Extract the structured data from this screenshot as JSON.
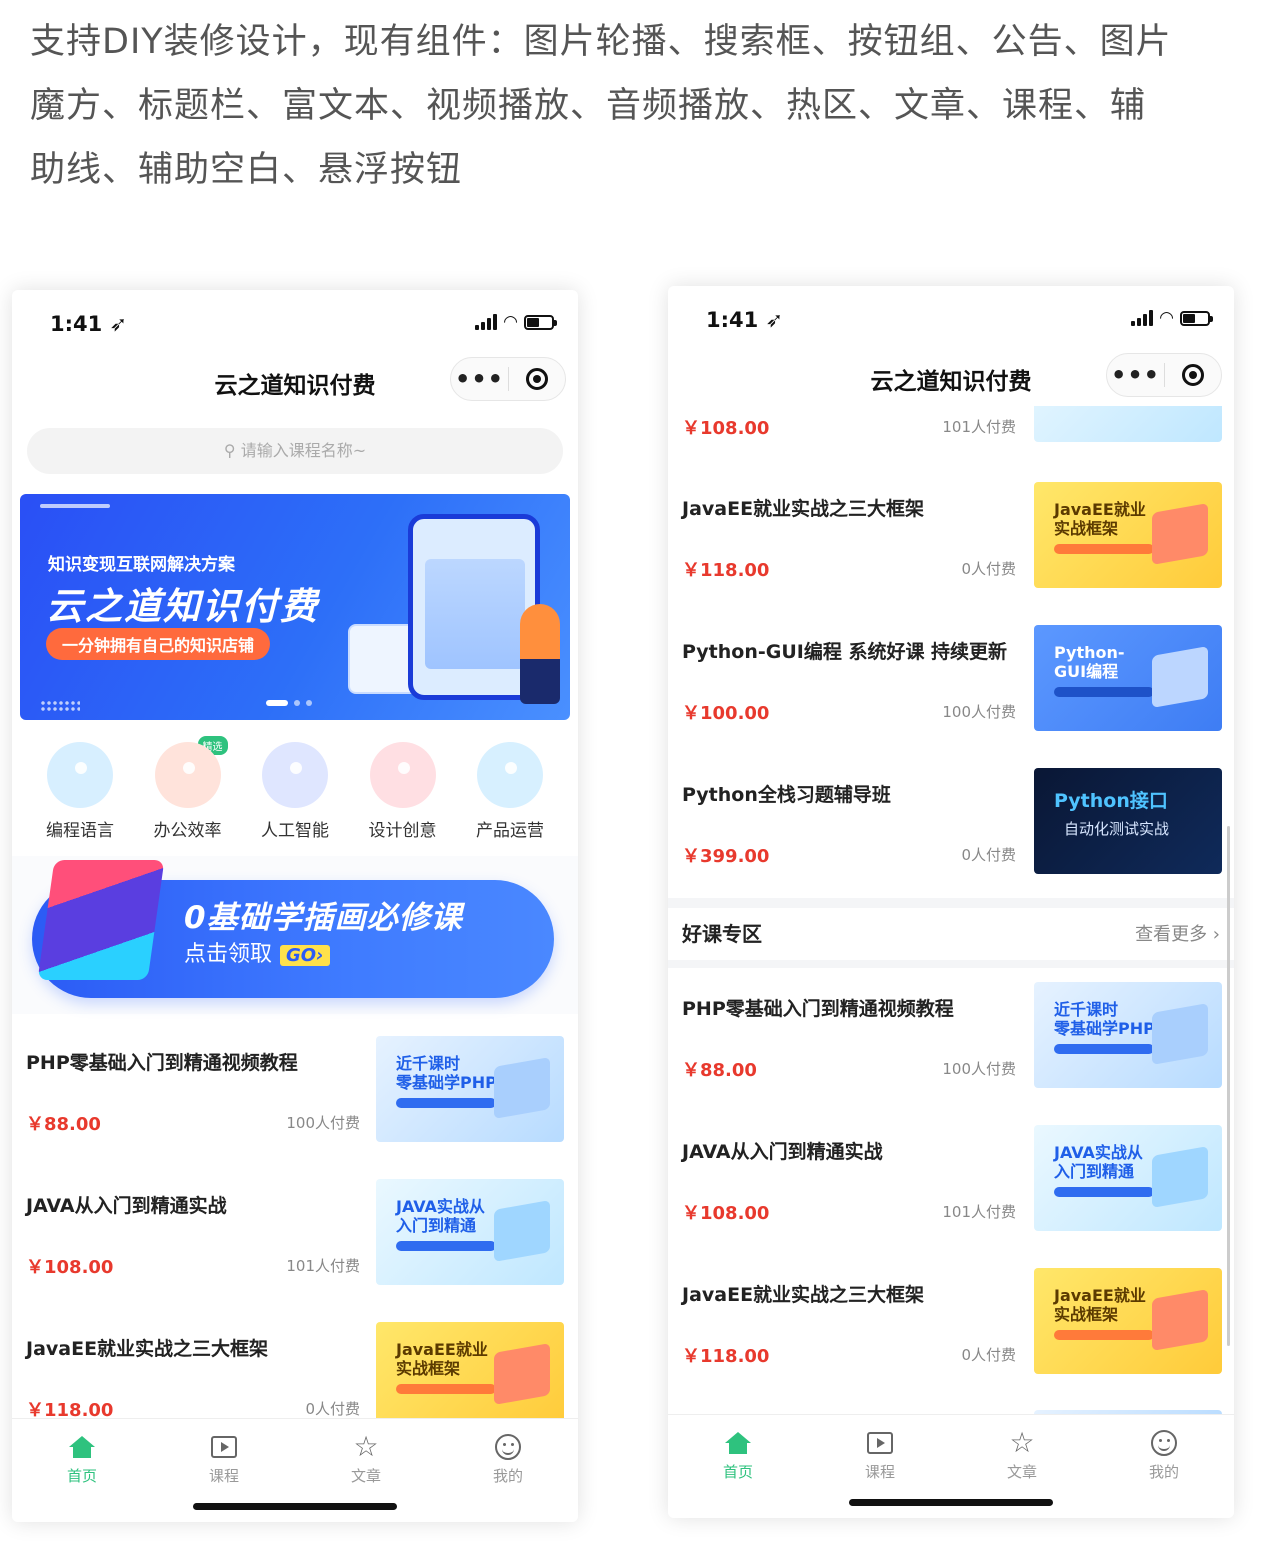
{
  "intro": {
    "lines": [
      "支持DIY装修设计，现有组件：图片轮播、搜索框、按钮组、公告、图片",
      "魔方、标题栏、富文本、视频播放、音频播放、热区、文章、课程、辅",
      "助线、辅助空白、悬浮按钮"
    ]
  },
  "left": {
    "status_time": "1:41",
    "nav_title": "云之道知识付费",
    "search_placeholder": "请输入课程名称~",
    "banner": {
      "sub": "知识变现互联网解决方案",
      "big": "云之道知识付费",
      "pill": "一分钟拥有自己的知识店铺"
    },
    "categories": [
      {
        "label": "编程语言",
        "color": "#d7efff"
      },
      {
        "label": "办公效率",
        "color": "#ffe3db",
        "tag": "精选"
      },
      {
        "label": "人工智能",
        "color": "#dfe6ff"
      },
      {
        "label": "设计创意",
        "color": "#ffdfe3"
      },
      {
        "label": "产品运营",
        "color": "#d7f0ff"
      }
    ],
    "promo": {
      "t1": "0基础学插画必修课",
      "t2": "点击领取",
      "go": "GO›"
    },
    "courses": [
      {
        "name": "PHP零基础入门到精通视频教程",
        "price": "￥88.00",
        "count": "100人付费",
        "thumb_title": "近千课时\n零基础学PHP"
      },
      {
        "name": "JAVA从入门到精通实战",
        "price": "￥108.00",
        "count": "101人付费",
        "thumb_title": "JAVA实战从\n入门到精通"
      },
      {
        "name": "JavaEE就业实战之三大框架",
        "price": "￥118.00",
        "count": "0人付费",
        "thumb_title": "JavaEE就业\n实战框架"
      }
    ]
  },
  "right": {
    "status_time": "1:41",
    "nav_title": "云之道知识付费",
    "top_partial": {
      "price": "￥108.00",
      "count": "101人付费"
    },
    "courses_a": [
      {
        "name": "JavaEE就业实战之三大框架",
        "price": "￥118.00",
        "count": "0人付费",
        "thumb_title": "JavaEE就业\n实战框架"
      },
      {
        "name": "Python-GUI编程 系统好课 持续更新",
        "price": "￥100.00",
        "count": "100人付费",
        "thumb_title": "Python-\nGUI编程"
      },
      {
        "name": "Python全栈习题辅导班",
        "price": "￥399.00",
        "count": "0人付费",
        "thumb_title": "Python接口",
        "thumb_sub": "自动化测试实战"
      }
    ],
    "section": {
      "title": "好课专区",
      "more": "查看更多 ›"
    },
    "courses_b": [
      {
        "name": "PHP零基础入门到精通视频教程",
        "price": "￥88.00",
        "count": "100人付费",
        "thumb_title": "近千课时\n零基础学PHP"
      },
      {
        "name": "JAVA从入门到精通实战",
        "price": "￥108.00",
        "count": "101人付费",
        "thumb_title": "JAVA实战从\n入门到精通"
      },
      {
        "name": "JavaEE就业实战之三大框架",
        "price": "￥118.00",
        "count": "0人付费",
        "thumb_title": "JavaEE就业\n实战框架"
      }
    ]
  },
  "tabbar": {
    "items": [
      {
        "label": "首页",
        "icon": "home-icon",
        "active": true
      },
      {
        "label": "课程",
        "icon": "video-icon"
      },
      {
        "label": "文章",
        "icon": "star-icon"
      },
      {
        "label": "我的",
        "icon": "smile-icon"
      }
    ]
  },
  "colors": {
    "accent_green": "#2ec27e",
    "price_red": "#e8392d",
    "banner_blue": "#2d6ff8"
  }
}
